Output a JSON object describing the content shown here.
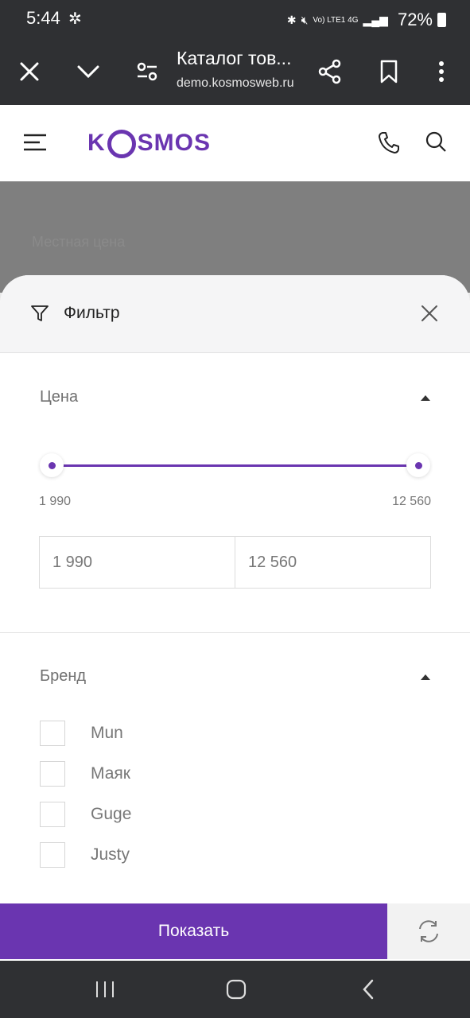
{
  "status_bar": {
    "time": "5:44",
    "network": "Vo) LTE1 4G",
    "battery": "72%"
  },
  "browser": {
    "title": "Каталог тов...",
    "url": "demo.kosmosweb.ru"
  },
  "site": {
    "logo_left": "K",
    "logo_right": "SMOS",
    "ghost_text": "Местная цена"
  },
  "filter": {
    "title": "Фильтр",
    "price": {
      "label": "Цена",
      "min_label": "1 990",
      "max_label": "12 560",
      "min_value": "1 990",
      "max_value": "12 560"
    },
    "brand": {
      "label": "Бренд",
      "items": [
        {
          "label": "Mun",
          "checked": false
        },
        {
          "label": "Маяк",
          "checked": false
        },
        {
          "label": "Guge",
          "checked": false
        },
        {
          "label": "Justy",
          "checked": false
        }
      ]
    },
    "show_button": "Показать"
  },
  "colors": {
    "accent": "#6a35b0",
    "system_bar": "#2f3033"
  }
}
